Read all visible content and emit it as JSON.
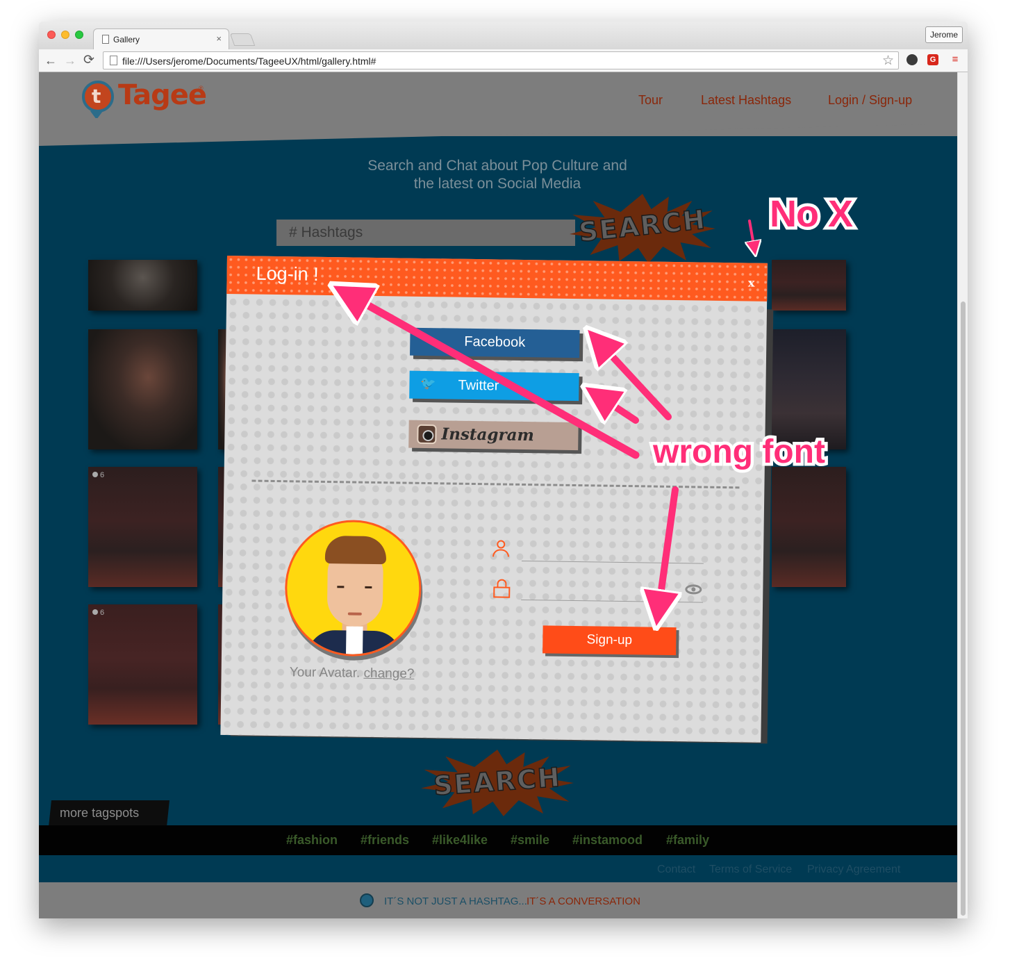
{
  "browser": {
    "tab_title": "Gallery",
    "tab_close": "×",
    "url": "file:///Users/jerome/Documents/TageeUX/html/gallery.html#",
    "profile_name": "Jerome",
    "nav_back": "←",
    "nav_forward": "→",
    "nav_reload": "⟳",
    "bookmark_star": "☆",
    "menu_glyph": "≡",
    "ext_g": "G"
  },
  "site": {
    "logo_text": "Tagee",
    "logo_mark": "t",
    "logo_reg": "®",
    "nav": {
      "tour": "Tour",
      "latest": "Latest Hashtags",
      "login": "Login / Sign-up"
    },
    "hero_line1": "Search and Chat about Pop Culture and",
    "hero_line2": "the latest on Social Media",
    "search_placeholder": "# Hashtags",
    "search_burst": "SEARCH",
    "more_tagspots": "more tagspots",
    "hashtags": [
      "#fashion",
      "#friends",
      "#like4like",
      "#smile",
      "#instamood",
      "#family"
    ],
    "footer_links": {
      "contact": "Contact",
      "terms": "Terms of Service",
      "privacy": "Privacy Agreement"
    },
    "tagline_part1": "IT´S NOT JUST A HASHTAG...",
    "tagline_part2": "IT´S A CONVERSATION",
    "thumb_counts": [
      "6",
      "6"
    ]
  },
  "modal": {
    "title": "Log-in !",
    "close": "x",
    "facebook": "Facebook",
    "twitter": "Twitter",
    "twitter_icon": "🐦",
    "instagram": "Instagram",
    "avatar_caption": "Your Avatar.",
    "avatar_change": "change?",
    "signup": "Sign-up"
  },
  "annotations": {
    "no_x": "No X",
    "wrong_font": "wrong font",
    "arrow_color": "#ff2e78"
  },
  "colors": {
    "page_bg": "#003a53",
    "header_gray": "#7d7d7d",
    "brand_orange": "#ff5a1f",
    "facebook_blue": "#245f95",
    "twitter_blue": "#0e9ee4",
    "instagram_tan": "#b89f93"
  }
}
